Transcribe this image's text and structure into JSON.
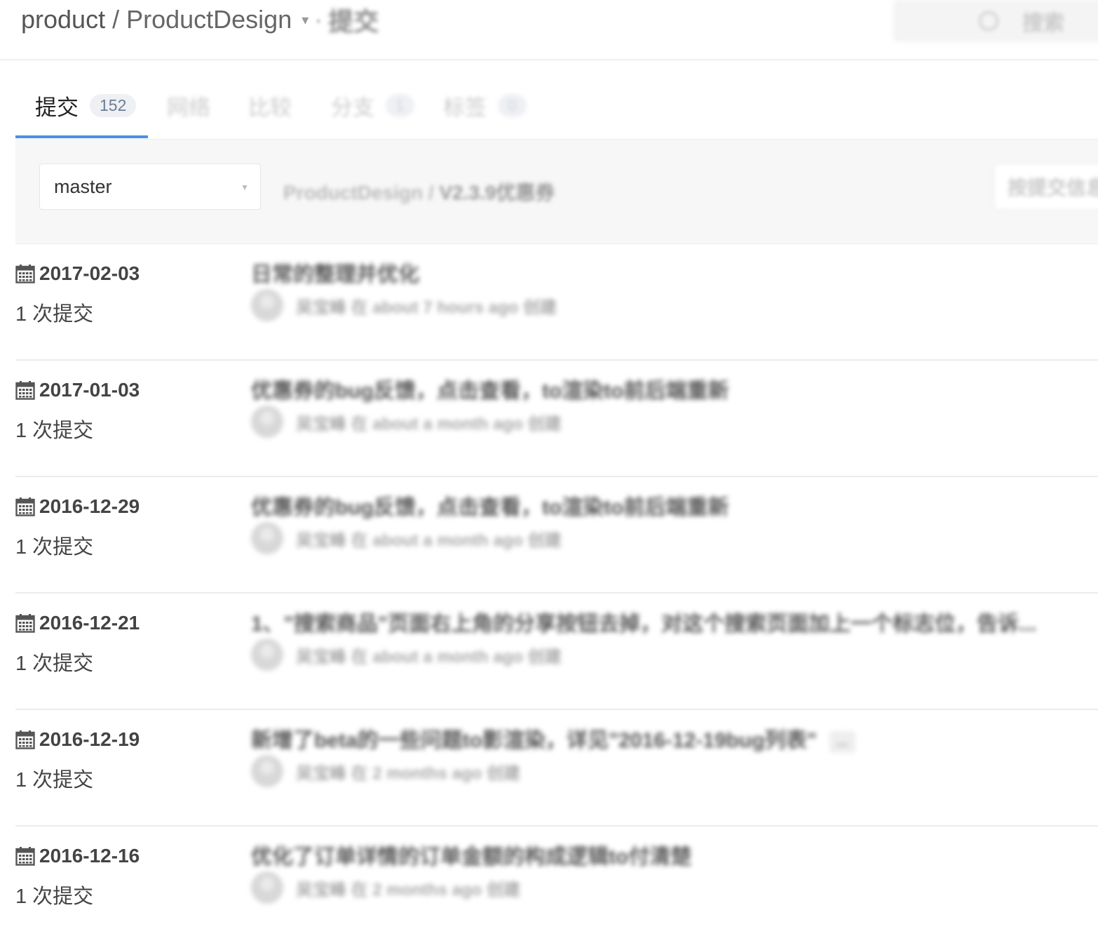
{
  "header": {
    "group": "product",
    "separator": "/",
    "repo": "ProductDesign",
    "caret": "▾",
    "dot": "·",
    "page": "提交",
    "search_label": "搜索"
  },
  "tabs": [
    {
      "label": "提交",
      "badge": "152"
    },
    {
      "label": "网络",
      "badge": ""
    },
    {
      "label": "比较",
      "badge": ""
    },
    {
      "label": "分支",
      "badge": "1"
    },
    {
      "label": "标签",
      "badge": "0"
    }
  ],
  "toolbar": {
    "branch": "master",
    "path_repo": "ProductDesign",
    "path_sep": " / ",
    "path_dir": "V2.3.9优惠券",
    "filter_placeholder": "按提交信息搜索"
  },
  "commits": [
    {
      "date": "2017-02-03",
      "count": "1 次提交",
      "message": "日常的整理并优化",
      "meta": "吴宝峰 在 about 7 hours ago 创建",
      "more": ""
    },
    {
      "date": "2017-01-03",
      "count": "1 次提交",
      "message": "优惠券的bug反馈，点击查看，to渲染to前后端重新",
      "meta": "吴宝峰 在 about a month ago 创建",
      "more": ""
    },
    {
      "date": "2016-12-29",
      "count": "1 次提交",
      "message": "优惠券的bug反馈，点击查看，to渲染to前后端重新",
      "meta": "吴宝峰 在 about a month ago 创建",
      "more": ""
    },
    {
      "date": "2016-12-21",
      "count": "1 次提交",
      "message": "1、\"搜索商品\"页面右上角的分享按钮去掉，对这个搜索页面加上一个标志位，告诉...",
      "meta": "吴宝峰 在 about a month ago 创建",
      "more": ""
    },
    {
      "date": "2016-12-19",
      "count": "1 次提交",
      "message": "新增了beta的一些问题to影渲染，详见\"2016-12-19bug列表\"",
      "meta": "吴宝峰 在 2 months ago 创建",
      "more": "..."
    },
    {
      "date": "2016-12-16",
      "count": "1 次提交",
      "message": "优化了订单详情的订单金额的构成逻辑to付清楚",
      "meta": "吴宝峰 在 2 months ago 创建",
      "more": ""
    }
  ],
  "colors": {
    "accent": "#4a90e2",
    "badge_bg": "#eef0f3",
    "toolbar_bg": "#f7f7f7"
  }
}
